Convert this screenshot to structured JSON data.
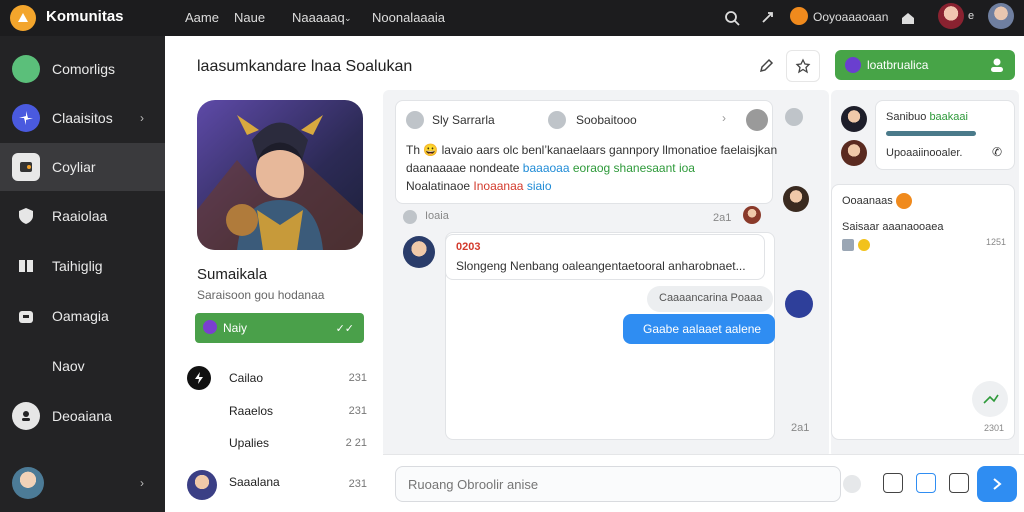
{
  "app": {
    "name": "Komunitas"
  },
  "topnav": {
    "items": [
      "Aame",
      "Naue",
      "Naaaaaq",
      "Noonalaaaia"
    ],
    "user_label": "Ooyoaaaoaan",
    "notif_text": "e"
  },
  "sidebar": {
    "items": [
      {
        "label": "Comorligs"
      },
      {
        "label": "Claaisitos"
      },
      {
        "label": "Coyliar"
      },
      {
        "label": "Raaiolaa"
      },
      {
        "label": "Taihiglig"
      },
      {
        "label": "Oamagia"
      },
      {
        "label": "Naov"
      },
      {
        "label": "Deoaiana"
      }
    ],
    "footer_chevron": "›"
  },
  "header": {
    "title": "laasumkandare lnaa Soalukan",
    "green_button": "loatbrualica"
  },
  "profile": {
    "name": "Sumaikala",
    "sub": "Saraisoon gou hodanaa",
    "green_button": "Naiy",
    "green_badge": "✓✓",
    "rows": [
      {
        "label": "Cailao",
        "time": "231"
      },
      {
        "label": "Raaelos",
        "time": "231"
      },
      {
        "label": "Upalies",
        "time": "2 21"
      },
      {
        "label": "Saaalana",
        "time": "231"
      }
    ]
  },
  "chat": {
    "top_card": {
      "left_label": "Sly Sarrarla",
      "mid_label": "Soobaitooo",
      "lines": [
        "Th 😀 lavaio aars olc benl’kanaelaars gannpory llmonatioe faelaisjkan",
        "daanaaaae nondeate",
        "baaaoaa",
        "eoraog shanesaant ioa",
        "Noalatinaoe",
        "Inoaanaa",
        "siaio"
      ]
    },
    "meta_row": {
      "label": "Ioaia",
      "time": "2a1"
    },
    "msg_card": {
      "title": "0203",
      "body": "Slongeng Nenbang oaleangentaetooral anharobnaet..."
    },
    "reply_pill": "Caaaancarina Poaaa",
    "sent_pill": "Gaabe aalaaet aalene",
    "card_time": "2a1",
    "time_top": "2a1"
  },
  "right": {
    "contact_card": {
      "name": "Sanibuo",
      "status": "baakaai",
      "sub": "Upoaaiinooaler."
    },
    "group_card": {
      "title": "Ooaanaas",
      "line": "Saisaar aaanaooaea",
      "time": "1251",
      "bottom_time": "2301"
    }
  },
  "composer": {
    "placeholder": "Ruoang Obroolir anise"
  }
}
